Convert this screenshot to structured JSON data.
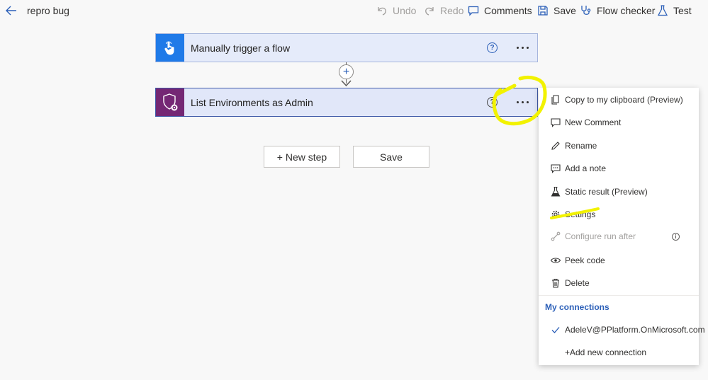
{
  "header": {
    "flow_name": "repro bug",
    "commands": {
      "undo": "Undo",
      "redo": "Redo",
      "comments": "Comments",
      "save": "Save",
      "flow_checker": "Flow checker",
      "test": "Test"
    }
  },
  "canvas": {
    "trigger_title": "Manually trigger a flow",
    "action_title": "List Environments as Admin",
    "help_glyph": "?",
    "add_glyph": "+",
    "new_step_label": "+ New step",
    "save_label": "Save"
  },
  "context_menu": {
    "items": [
      {
        "label": "Copy to my clipboard (Preview)",
        "icon": "copy-icon"
      },
      {
        "label": "New Comment",
        "icon": "comment-icon"
      },
      {
        "label": "Rename",
        "icon": "pencil-icon"
      },
      {
        "label": "Add a note",
        "icon": "note-icon"
      },
      {
        "label": "Static result (Preview)",
        "icon": "flask-icon"
      },
      {
        "label": "Settings",
        "icon": "gear-icon"
      },
      {
        "label": "Configure run after",
        "icon": "run-after-icon",
        "disabled": true
      },
      {
        "label": "Peek code",
        "icon": "eye-icon"
      },
      {
        "label": "Delete",
        "icon": "trash-icon"
      }
    ],
    "info_glyph": "i",
    "section_title": "My connections",
    "connection": "AdeleV@PPlatform.OnMicrosoft.com",
    "add_connection": "+Add new connection"
  },
  "colors": {
    "accent": "#2b5fb8",
    "trigger_icon_bg": "#1f7ae8",
    "action_icon_bg": "#742774",
    "highlight": "#f2f200"
  }
}
